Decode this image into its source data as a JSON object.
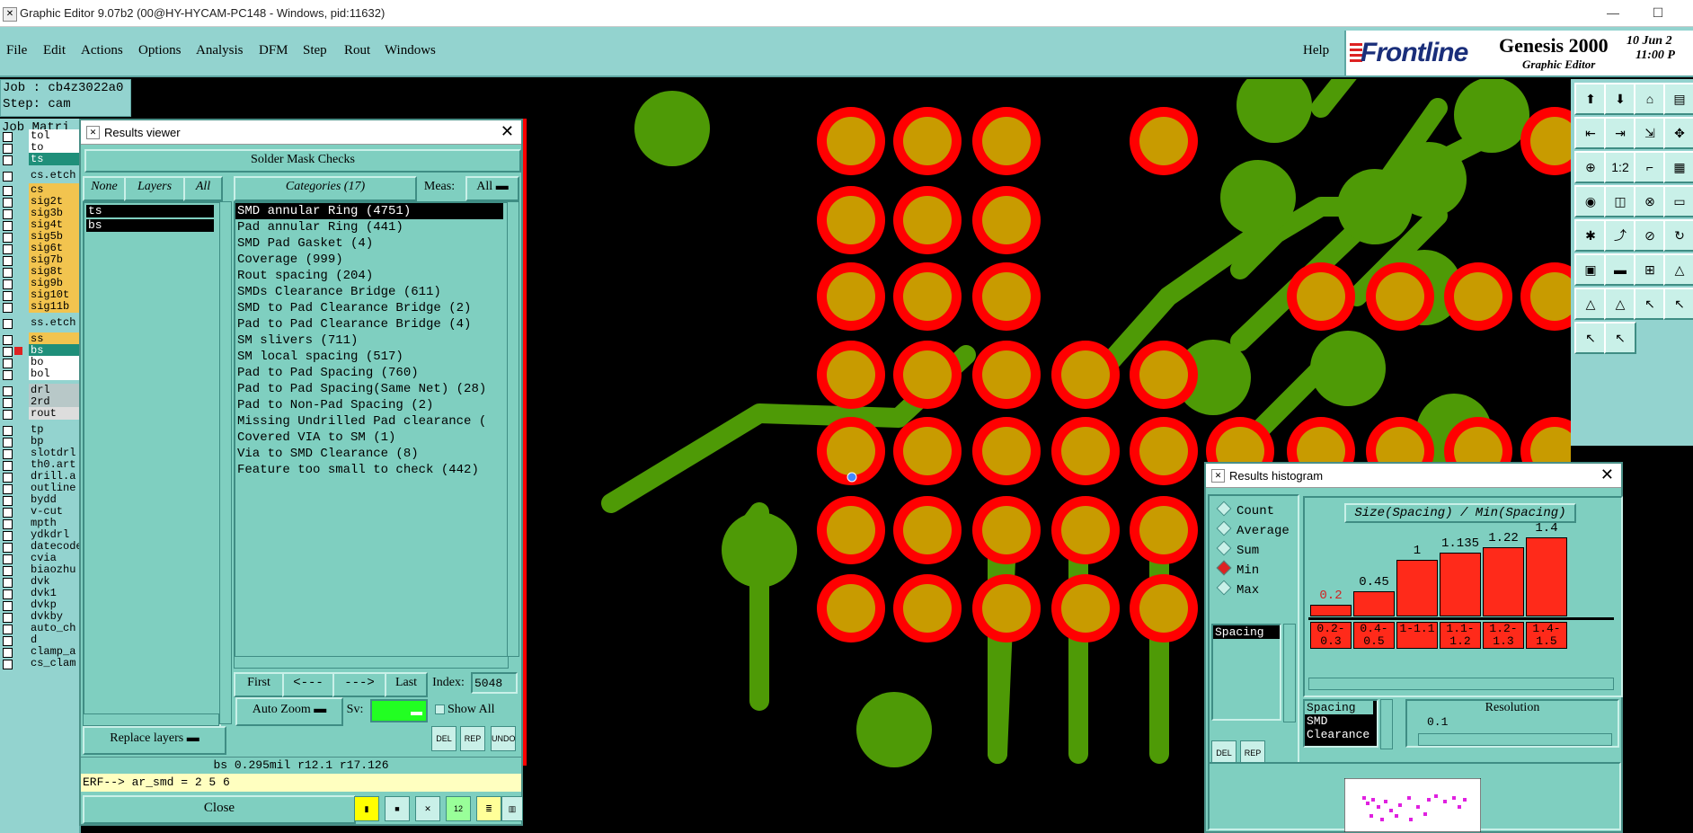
{
  "window": {
    "title": "Graphic Editor 9.07b2 (00@HY-HYCAM-PC148 - Windows, pid:11632)",
    "minimize": "—",
    "maximize": "☐"
  },
  "menu": {
    "items": [
      "File",
      "Edit",
      "Actions",
      "Options",
      "Analysis",
      "DFM",
      "Step",
      "Rout",
      "Windows"
    ],
    "help": "Help"
  },
  "branding": {
    "logo": "Frontline",
    "product": "Genesis 2000",
    "subtitle": "Graphic Editor",
    "date": "10 Jun 2",
    "time": "11:00 P"
  },
  "job": {
    "job_line": "Job : cb4z3022a0",
    "step_line": "Step: cam"
  },
  "job_matrix": {
    "title": "Job Matri",
    "layers": [
      {
        "name": "tol",
        "color": "#ffffff"
      },
      {
        "name": "to",
        "color": "#ffffff"
      },
      {
        "name": "ts",
        "color": "#1f8f7a"
      },
      {
        "name": "cs.etch",
        "color": "#93d3cf"
      },
      {
        "name": "cs",
        "color": "#f2c44f"
      },
      {
        "name": "sig2t",
        "color": "#f2c44f"
      },
      {
        "name": "sig3b",
        "color": "#f2c44f"
      },
      {
        "name": "sig4t",
        "color": "#f2c44f"
      },
      {
        "name": "sig5b",
        "color": "#f2c44f"
      },
      {
        "name": "sig6t",
        "color": "#f2c44f"
      },
      {
        "name": "sig7b",
        "color": "#f2c44f"
      },
      {
        "name": "sig8t",
        "color": "#f2c44f"
      },
      {
        "name": "sig9b",
        "color": "#f2c44f"
      },
      {
        "name": "sig10t",
        "color": "#f2c44f"
      },
      {
        "name": "sig11b",
        "color": "#f2c44f"
      },
      {
        "name": "ss.etch",
        "color": "#93d3cf"
      },
      {
        "name": "ss",
        "color": "#f2c44f"
      },
      {
        "name": "bs",
        "color": "#1f8f7a"
      },
      {
        "name": "bo",
        "color": "#ffffff"
      },
      {
        "name": "bol",
        "color": "#ffffff"
      },
      {
        "name": "drl",
        "color": "#b8c8c8"
      },
      {
        "name": "2rd",
        "color": "#b8c8c8"
      },
      {
        "name": "rout",
        "color": "#dddddd"
      },
      {
        "name": "tp",
        "color": "#93d3cf"
      },
      {
        "name": "bp",
        "color": "#93d3cf"
      },
      {
        "name": "slotdrl",
        "color": "#93d3cf"
      },
      {
        "name": "th0.art",
        "color": "#93d3cf"
      },
      {
        "name": "drill.a",
        "color": "#93d3cf"
      },
      {
        "name": "outline",
        "color": "#93d3cf"
      },
      {
        "name": "bydd",
        "color": "#93d3cf"
      },
      {
        "name": "v-cut",
        "color": "#93d3cf"
      },
      {
        "name": "mpth",
        "color": "#93d3cf"
      },
      {
        "name": "ydkdrl",
        "color": "#93d3cf"
      },
      {
        "name": "datecode",
        "color": "#93d3cf"
      },
      {
        "name": "cvia",
        "color": "#93d3cf"
      },
      {
        "name": "biaozhu",
        "color": "#93d3cf"
      },
      {
        "name": "dvk",
        "color": "#93d3cf"
      },
      {
        "name": "dvk1",
        "color": "#93d3cf"
      },
      {
        "name": "dvkp",
        "color": "#93d3cf"
      },
      {
        "name": "dvkby",
        "color": "#93d3cf"
      },
      {
        "name": "auto_ch",
        "color": "#93d3cf"
      },
      {
        "name": "d",
        "color": "#93d3cf"
      },
      {
        "name": "clamp_a",
        "color": "#93d3cf"
      },
      {
        "name": "cs_clam",
        "color": "#93d3cf"
      }
    ]
  },
  "results_viewer": {
    "title": "Results viewer",
    "header": "Solder Mask Checks",
    "btn_none": "None",
    "btn_layers": "Layers",
    "btn_all": "All",
    "btn_categories": "Categories (17)",
    "meas_label": "Meas:",
    "meas_value": "All",
    "layers": [
      "ts",
      "bs"
    ],
    "categories": [
      "SMD annular Ring (4751)",
      "Pad annular Ring (441)",
      "SMD Pad Gasket (4)",
      "Coverage (999)",
      "Rout spacing (204)",
      "SMDs Clearance Bridge (611)",
      "SMD to Pad Clearance Bridge (2)",
      "Pad to Pad Clearance Bridge (4)",
      "SM slivers (711)",
      "SM local spacing (517)",
      "Pad to Pad Spacing (760)",
      "Pad to Pad Spacing(Same Net) (28)",
      "Pad to Non-Pad Spacing (2)",
      "Missing Undrilled Pad clearance (",
      "Covered VIA to SM (1)",
      "Via to SMD Clearance (8)",
      "Feature too small to check (442)"
    ],
    "nav_first": "First",
    "nav_prev": "<---",
    "nav_next": "--->",
    "nav_last": "Last",
    "index_label": "Index:",
    "index_value": "5048",
    "auto_zoom": "Auto Zoom",
    "sv_label": "Sv:",
    "show_all": "Show All",
    "replace_layers": "Replace layers",
    "del": "DEL",
    "rep": "REP",
    "undo": "UNDO",
    "status": "bs 0.295mil  r12.1  r17.126",
    "erf": "ERF--> ar_smd = 2 5 6",
    "close": "Close"
  },
  "histogram": {
    "title": "Results histogram",
    "modes": [
      "Count",
      "Average",
      "Sum",
      "Min",
      "Max"
    ],
    "selected_mode": "Min",
    "list_item": "Spacing",
    "panel_title": "Size(Spacing) / Min(Spacing)",
    "types": [
      "Spacing",
      "SMD",
      "Clearance"
    ],
    "resolution_label": "Resolution",
    "resolution_value": "0.1",
    "del": "DEL",
    "rep": "REP"
  },
  "chart_data": {
    "type": "bar",
    "title": "Size(Spacing) / Min(Spacing)",
    "categories": [
      "0.2-0.3",
      "0.4-0.5",
      "1-1.1",
      "1.1-1.2",
      "1.2-1.3",
      "1.4-1.5"
    ],
    "values": [
      0.2,
      0.45,
      1,
      1.135,
      1.22,
      1.4
    ],
    "value_labels": [
      "0.2",
      "0.45",
      "1",
      "1.135",
      "1.22",
      "1.4"
    ],
    "ylim": [
      0,
      1.4
    ],
    "grid": false,
    "bar_color": "#ff2a1a",
    "highlight_label_color": "#d22222"
  },
  "colors": {
    "panel": "#93d3cf",
    "dialog": "#7fcfc0",
    "copper": "#4e9a06",
    "pad": "#c89b00",
    "mask": "#ff0000"
  }
}
